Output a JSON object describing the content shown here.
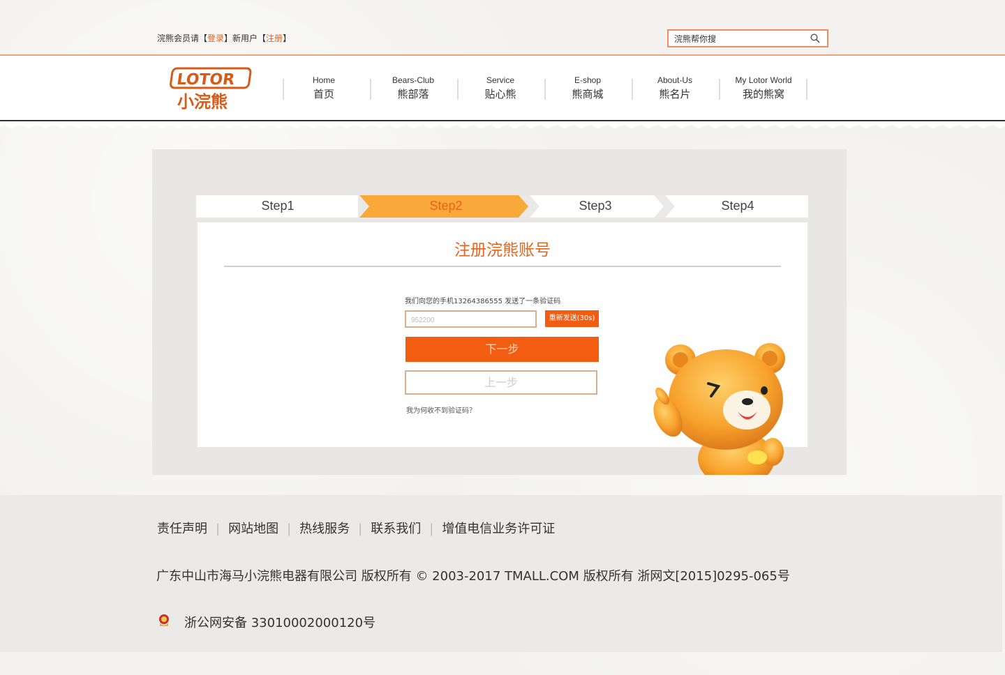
{
  "top": {
    "member_prefix": "浣熊会员请【",
    "login": "登录",
    "middle": "】新用户【",
    "register": "注册",
    "suffix": "】",
    "search_placeholder": "浣熊帮你搜"
  },
  "logo": {
    "en": "LOTOR",
    "cn": "小浣熊"
  },
  "nav": [
    {
      "en": "Home",
      "cn": "首页"
    },
    {
      "en": "Bears-Club",
      "cn": "熊部落"
    },
    {
      "en": "Service",
      "cn": "贴心熊"
    },
    {
      "en": "E-shop",
      "cn": "熊商城"
    },
    {
      "en": "About-Us",
      "cn": "熊名片"
    },
    {
      "en": "My Lotor World",
      "cn": "我的熊窝"
    }
  ],
  "steps": [
    {
      "label": "Step1",
      "active": false
    },
    {
      "label": "Step2",
      "active": true
    },
    {
      "label": "Step3",
      "active": false
    },
    {
      "label": "Step4",
      "active": false
    }
  ],
  "form": {
    "title": "注册浣熊账号",
    "message": "我们向您的手机13264386555 发送了一条验证码",
    "code_value": "952200",
    "resend_label": "重新发送(30s)",
    "next_label": "下一步",
    "prev_label": "上一步",
    "help_link": "我为何收不到验证码？"
  },
  "footer": {
    "links": [
      "责任声明",
      "网站地图",
      "热线服务",
      "联系我们",
      "增值电信业务许可证"
    ],
    "copyright": "广东中山市海马小浣熊电器有限公司 版权所有  © 2003-2017 TMALL.COM 版权所有  浙网文[2015]0295-065号",
    "beian": "浙公网安备 33010002000120号"
  },
  "colors": {
    "accent": "#f25d12",
    "step_active": "#f9a93a",
    "border": "#d9b08e"
  }
}
